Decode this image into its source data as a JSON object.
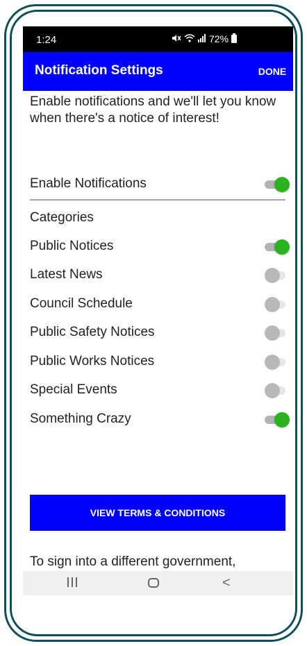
{
  "status_bar": {
    "time": "1:24",
    "icons": [
      "mute-icon",
      "wifi-icon",
      "signal-icon"
    ],
    "battery": "72%"
  },
  "app_bar": {
    "title": "Notification Settings",
    "done_label": "DONE",
    "color": "#0000ff"
  },
  "intro_text": "Enable notifications and we'll let you know when there's a notice of interest!",
  "enable_notifications": {
    "label": "Enable Notifications",
    "enabled": true
  },
  "categories_heading": "Categories",
  "categories": [
    {
      "label": "Public Notices",
      "enabled": true
    },
    {
      "label": "Latest News",
      "enabled": false
    },
    {
      "label": "Council Schedule",
      "enabled": false
    },
    {
      "label": "Public Safety Notices",
      "enabled": false
    },
    {
      "label": "Public Works Notices",
      "enabled": false
    },
    {
      "label": "Special Events",
      "enabled": false
    },
    {
      "label": "Something Crazy",
      "enabled": true
    }
  ],
  "terms_button_label": "VIEW TERMS & CONDITIONS",
  "footer_text": "To sign into a different government,",
  "nav_bar": {
    "recent_icon": "recent-apps-icon",
    "home_icon": "home-icon",
    "back_icon": "back-icon",
    "back_glyph": "<"
  },
  "colors": {
    "accent": "#0000ff",
    "toggle_on": "#2ab31f",
    "toggle_off": "#b8b8b8"
  }
}
